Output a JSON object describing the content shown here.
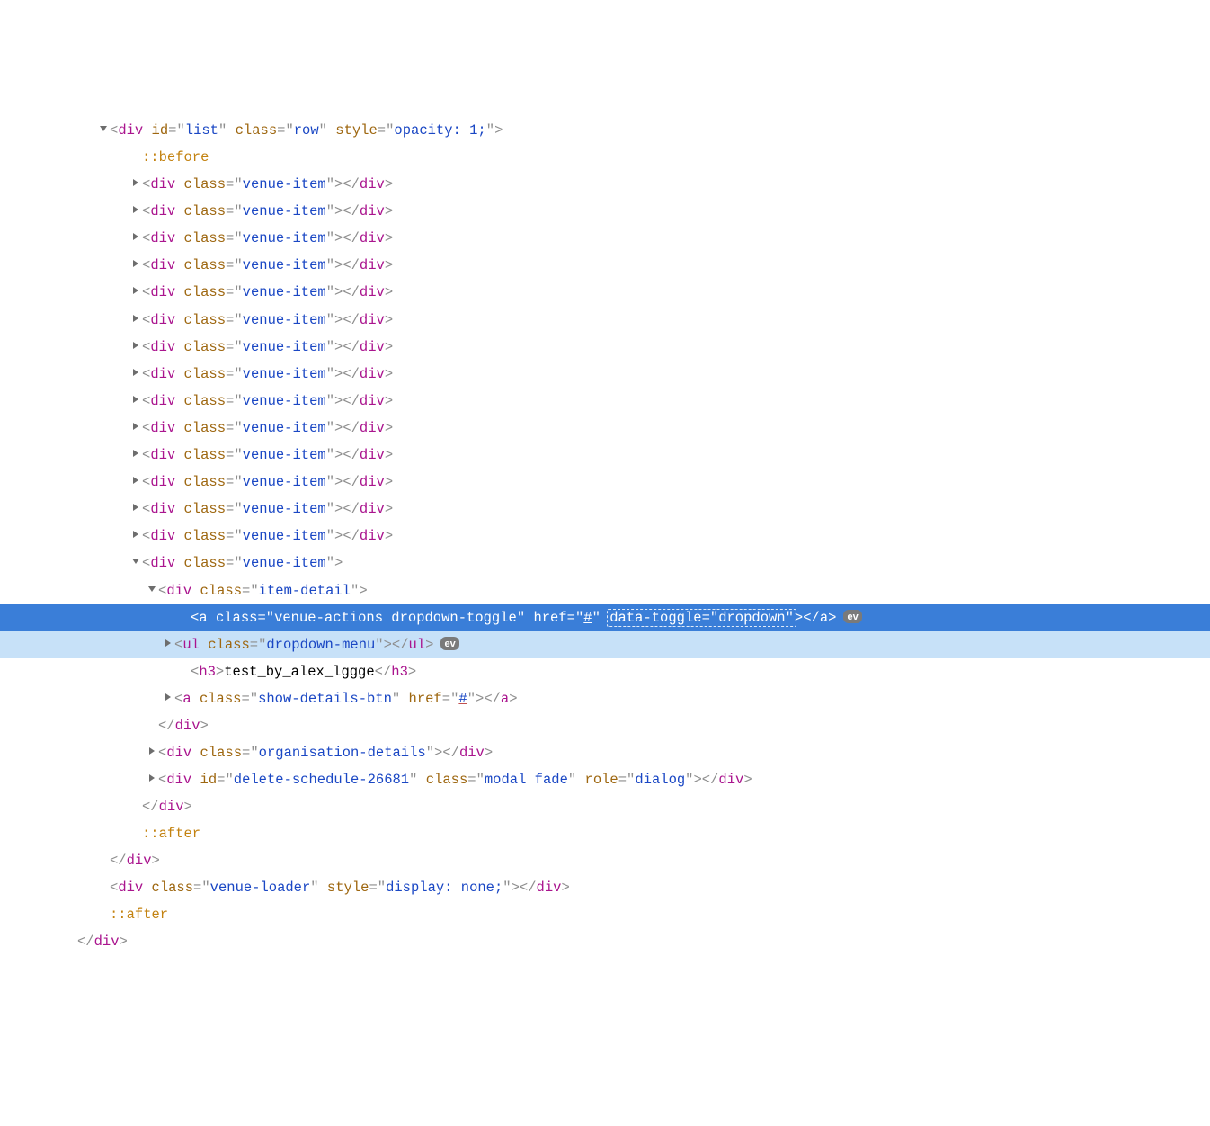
{
  "ev_label": "ev",
  "pseudo_before": "::before",
  "pseudo_after": "::after",
  "punct": {
    "open": "<",
    "close": ">",
    "slash": "/",
    "eq": "=",
    "q": "\""
  },
  "lines": [
    {
      "indent": 6,
      "arrow": "down",
      "kind": "open",
      "segs": [
        {
          "t": "tag",
          "v": "div"
        },
        {
          "t": "sp"
        },
        {
          "t": "attr",
          "v": "id"
        },
        {
          "t": "eq"
        },
        {
          "t": "val",
          "v": "list"
        },
        {
          "t": "sp"
        },
        {
          "t": "attr",
          "v": "class"
        },
        {
          "t": "eq"
        },
        {
          "t": "val",
          "v": "row"
        },
        {
          "t": "sp"
        },
        {
          "t": "attr",
          "v": "style"
        },
        {
          "t": "eq"
        },
        {
          "t": "val",
          "v": "opacity: 1;"
        }
      ]
    },
    {
      "indent": 8,
      "arrow": "none",
      "kind": "pseudo",
      "text": "before"
    },
    {
      "indent": 8,
      "arrow": "right",
      "kind": "pair",
      "tag": "div",
      "segs": [
        {
          "t": "attr",
          "v": "class"
        },
        {
          "t": "eq"
        },
        {
          "t": "val",
          "v": "venue-item"
        }
      ]
    },
    {
      "indent": 8,
      "arrow": "right",
      "kind": "pair",
      "tag": "div",
      "segs": [
        {
          "t": "attr",
          "v": "class"
        },
        {
          "t": "eq"
        },
        {
          "t": "val",
          "v": "venue-item"
        }
      ]
    },
    {
      "indent": 8,
      "arrow": "right",
      "kind": "pair",
      "tag": "div",
      "segs": [
        {
          "t": "attr",
          "v": "class"
        },
        {
          "t": "eq"
        },
        {
          "t": "val",
          "v": "venue-item"
        }
      ]
    },
    {
      "indent": 8,
      "arrow": "right",
      "kind": "pair",
      "tag": "div",
      "segs": [
        {
          "t": "attr",
          "v": "class"
        },
        {
          "t": "eq"
        },
        {
          "t": "val",
          "v": "venue-item"
        }
      ]
    },
    {
      "indent": 8,
      "arrow": "right",
      "kind": "pair",
      "tag": "div",
      "segs": [
        {
          "t": "attr",
          "v": "class"
        },
        {
          "t": "eq"
        },
        {
          "t": "val",
          "v": "venue-item"
        }
      ]
    },
    {
      "indent": 8,
      "arrow": "right",
      "kind": "pair",
      "tag": "div",
      "segs": [
        {
          "t": "attr",
          "v": "class"
        },
        {
          "t": "eq"
        },
        {
          "t": "val",
          "v": "venue-item"
        }
      ]
    },
    {
      "indent": 8,
      "arrow": "right",
      "kind": "pair",
      "tag": "div",
      "segs": [
        {
          "t": "attr",
          "v": "class"
        },
        {
          "t": "eq"
        },
        {
          "t": "val",
          "v": "venue-item"
        }
      ]
    },
    {
      "indent": 8,
      "arrow": "right",
      "kind": "pair",
      "tag": "div",
      "segs": [
        {
          "t": "attr",
          "v": "class"
        },
        {
          "t": "eq"
        },
        {
          "t": "val",
          "v": "venue-item"
        }
      ]
    },
    {
      "indent": 8,
      "arrow": "right",
      "kind": "pair",
      "tag": "div",
      "segs": [
        {
          "t": "attr",
          "v": "class"
        },
        {
          "t": "eq"
        },
        {
          "t": "val",
          "v": "venue-item"
        }
      ]
    },
    {
      "indent": 8,
      "arrow": "right",
      "kind": "pair",
      "tag": "div",
      "segs": [
        {
          "t": "attr",
          "v": "class"
        },
        {
          "t": "eq"
        },
        {
          "t": "val",
          "v": "venue-item"
        }
      ]
    },
    {
      "indent": 8,
      "arrow": "right",
      "kind": "pair",
      "tag": "div",
      "segs": [
        {
          "t": "attr",
          "v": "class"
        },
        {
          "t": "eq"
        },
        {
          "t": "val",
          "v": "venue-item"
        }
      ]
    },
    {
      "indent": 8,
      "arrow": "right",
      "kind": "pair",
      "tag": "div",
      "segs": [
        {
          "t": "attr",
          "v": "class"
        },
        {
          "t": "eq"
        },
        {
          "t": "val",
          "v": "venue-item"
        }
      ]
    },
    {
      "indent": 8,
      "arrow": "right",
      "kind": "pair",
      "tag": "div",
      "segs": [
        {
          "t": "attr",
          "v": "class"
        },
        {
          "t": "eq"
        },
        {
          "t": "val",
          "v": "venue-item"
        }
      ]
    },
    {
      "indent": 8,
      "arrow": "right",
      "kind": "pair",
      "tag": "div",
      "segs": [
        {
          "t": "attr",
          "v": "class"
        },
        {
          "t": "eq"
        },
        {
          "t": "val",
          "v": "venue-item"
        }
      ]
    },
    {
      "indent": 8,
      "arrow": "down",
      "kind": "open",
      "segs": [
        {
          "t": "tag",
          "v": "div"
        },
        {
          "t": "sp"
        },
        {
          "t": "attr",
          "v": "class"
        },
        {
          "t": "eq"
        },
        {
          "t": "val",
          "v": "venue-item"
        }
      ]
    },
    {
      "indent": 9,
      "arrow": "down",
      "kind": "open",
      "segs": [
        {
          "t": "tag",
          "v": "div"
        },
        {
          "t": "sp"
        },
        {
          "t": "attr",
          "v": "class"
        },
        {
          "t": "eq"
        },
        {
          "t": "val",
          "v": "item-detail"
        }
      ]
    },
    {
      "indent": 11,
      "arrow": "none",
      "kind": "pair",
      "tag": "a",
      "rowclass": "sel",
      "ev": true,
      "segs": [
        {
          "t": "attr",
          "v": "class"
        },
        {
          "t": "eq"
        },
        {
          "t": "val",
          "v": "venue-actions dropdown-toggle"
        },
        {
          "t": "sp"
        },
        {
          "t": "attr",
          "v": "href"
        },
        {
          "t": "eq"
        },
        {
          "t": "href",
          "v": "#"
        },
        {
          "t": "sp"
        },
        {
          "t": "bstart"
        },
        {
          "t": "attr",
          "v": "data-toggle"
        },
        {
          "t": "eq"
        },
        {
          "t": "val",
          "v": "dropdown"
        },
        {
          "t": "bend"
        }
      ]
    },
    {
      "indent": 10,
      "arrow": "right",
      "kind": "pair",
      "tag": "ul",
      "rowclass": "sel2",
      "ev": true,
      "segs": [
        {
          "t": "attr",
          "v": "class"
        },
        {
          "t": "eq"
        },
        {
          "t": "val",
          "v": "dropdown-menu"
        }
      ]
    },
    {
      "indent": 11,
      "arrow": "none",
      "kind": "textpair",
      "tag": "h3",
      "text": "test_by_alex_lggge"
    },
    {
      "indent": 10,
      "arrow": "right",
      "kind": "pair",
      "tag": "a",
      "segs": [
        {
          "t": "attr",
          "v": "class"
        },
        {
          "t": "eq"
        },
        {
          "t": "val",
          "v": "show-details-btn"
        },
        {
          "t": "sp"
        },
        {
          "t": "attr",
          "v": "href"
        },
        {
          "t": "eq"
        },
        {
          "t": "href",
          "v": "#"
        }
      ]
    },
    {
      "indent": 9,
      "arrow": "none",
      "kind": "close",
      "tag": "div"
    },
    {
      "indent": 9,
      "arrow": "right",
      "kind": "pair",
      "tag": "div",
      "segs": [
        {
          "t": "attr",
          "v": "class"
        },
        {
          "t": "eq"
        },
        {
          "t": "val",
          "v": "organisation-details"
        }
      ]
    },
    {
      "indent": 9,
      "arrow": "right",
      "kind": "pair",
      "tag": "div",
      "segs": [
        {
          "t": "attr",
          "v": "id"
        },
        {
          "t": "eq"
        },
        {
          "t": "val",
          "v": "delete-schedule-26681"
        },
        {
          "t": "sp"
        },
        {
          "t": "attr",
          "v": "class"
        },
        {
          "t": "eq"
        },
        {
          "t": "val",
          "v": "modal fade"
        },
        {
          "t": "sp"
        },
        {
          "t": "attr",
          "v": "role"
        },
        {
          "t": "eq"
        },
        {
          "t": "val",
          "v": "dialog"
        }
      ]
    },
    {
      "indent": 8,
      "arrow": "none",
      "kind": "close",
      "tag": "div"
    },
    {
      "indent": 8,
      "arrow": "none",
      "kind": "pseudo",
      "text": "after"
    },
    {
      "indent": 6,
      "arrow": "none",
      "kind": "close",
      "tag": "div"
    },
    {
      "indent": 6,
      "arrow": "none",
      "kind": "pair",
      "tag": "div",
      "segs": [
        {
          "t": "attr",
          "v": "class"
        },
        {
          "t": "eq"
        },
        {
          "t": "val",
          "v": "venue-loader"
        },
        {
          "t": "sp"
        },
        {
          "t": "attr",
          "v": "style"
        },
        {
          "t": "eq"
        },
        {
          "t": "val",
          "v": "display: none;"
        }
      ]
    },
    {
      "indent": 6,
      "arrow": "none",
      "kind": "pseudo",
      "text": "after"
    },
    {
      "indent": 4,
      "arrow": "none",
      "kind": "close",
      "tag": "div"
    }
  ]
}
